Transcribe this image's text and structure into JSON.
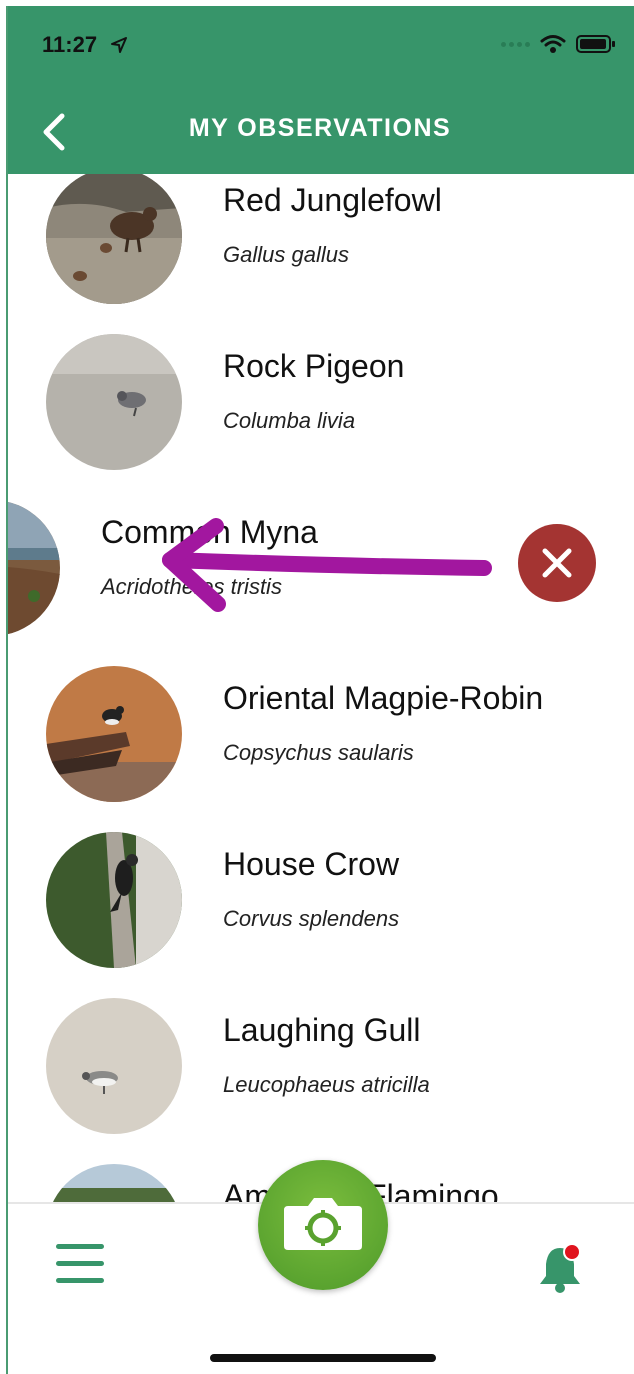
{
  "status_bar": {
    "time": "11:27"
  },
  "header": {
    "title": "MY OBSERVATIONS"
  },
  "observations": [
    {
      "common": "Red Junglefowl",
      "scientific": "Gallus gallus"
    },
    {
      "common": "Rock Pigeon",
      "scientific": "Columba livia"
    },
    {
      "common": "Common Myna",
      "scientific": "Acridotheres tristis"
    },
    {
      "common": "Oriental Magpie-Robin",
      "scientific": "Copsychus saularis"
    },
    {
      "common": "House Crow",
      "scientific": "Corvus splendens"
    },
    {
      "common": "Laughing Gull",
      "scientific": "Leucophaeus atricilla"
    },
    {
      "common": "American Flamingo",
      "scientific": ""
    }
  ],
  "colors": {
    "header": "#37956a",
    "delete": "#a43432",
    "arrow": "#a2179f",
    "camera": "#62aa32",
    "notification_dot": "#e0141e"
  },
  "icons": {
    "back": "chevron-left-icon",
    "delete": "close-icon",
    "menu": "hamburger-icon",
    "camera": "camera-icon",
    "notifications": "bell-icon"
  }
}
